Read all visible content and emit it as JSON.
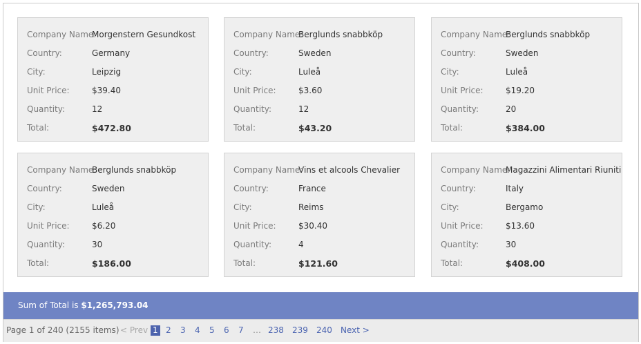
{
  "labels": {
    "company": "Company Name:",
    "country": "Country:",
    "city": "City:",
    "unit_price": "Unit Price:",
    "quantity": "Quantity:",
    "total": "Total:"
  },
  "cards": [
    {
      "company": "Morgenstern Gesundkost",
      "country": "Germany",
      "city": "Leipzig",
      "unit_price": "$39.40",
      "quantity": "12",
      "total": "$472.80"
    },
    {
      "company": "Berglunds snabbköp",
      "country": "Sweden",
      "city": "Luleå",
      "unit_price": "$3.60",
      "quantity": "12",
      "total": "$43.20"
    },
    {
      "company": "Berglunds snabbköp",
      "country": "Sweden",
      "city": "Luleå",
      "unit_price": "$19.20",
      "quantity": "20",
      "total": "$384.00"
    },
    {
      "company": "Berglunds snabbköp",
      "country": "Sweden",
      "city": "Luleå",
      "unit_price": "$6.20",
      "quantity": "30",
      "total": "$186.00"
    },
    {
      "company": "Vins et alcools Chevalier",
      "country": "France",
      "city": "Reims",
      "unit_price": "$30.40",
      "quantity": "4",
      "total": "$121.60"
    },
    {
      "company": "Magazzini Alimentari Riuniti",
      "country": "Italy",
      "city": "Bergamo",
      "unit_price": "$13.60",
      "quantity": "30",
      "total": "$408.00"
    }
  ],
  "summary": {
    "prefix": "Sum of Total is ",
    "amount": "$1,265,793.04"
  },
  "pager": {
    "info": "Page 1 of 240 (2155 items)",
    "prev": "< Prev",
    "next": "Next >",
    "ellipsis": "…",
    "pages": [
      "1",
      "2",
      "3",
      "4",
      "5",
      "6",
      "7",
      "238",
      "239",
      "240"
    ],
    "current": "1"
  }
}
